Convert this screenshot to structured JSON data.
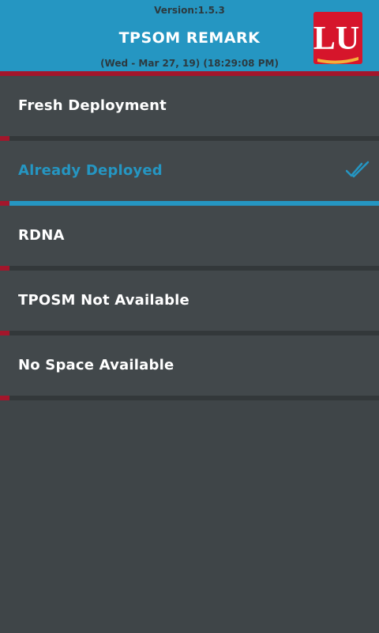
{
  "header": {
    "version": "Version:1.5.3",
    "title": "TPSOM REMARK",
    "datetime": "(Wed - Mar 27, 19) (18:29:08 PM)",
    "logo_text": "LU",
    "logo_icon": "lu-brand-logo"
  },
  "remarks": [
    {
      "label": "Fresh Deployment",
      "selected": false
    },
    {
      "label": "Already Deployed",
      "selected": true,
      "icon": "double-check-icon"
    },
    {
      "label": "RDNA",
      "selected": false
    },
    {
      "label": "TPOSM Not Available",
      "selected": false
    },
    {
      "label": "No Space Available",
      "selected": false
    }
  ],
  "colors": {
    "header_bg": "#2596c2",
    "accent_red": "#a3162b",
    "selected_blue": "#2596c2",
    "list_bg": "#42484b"
  }
}
